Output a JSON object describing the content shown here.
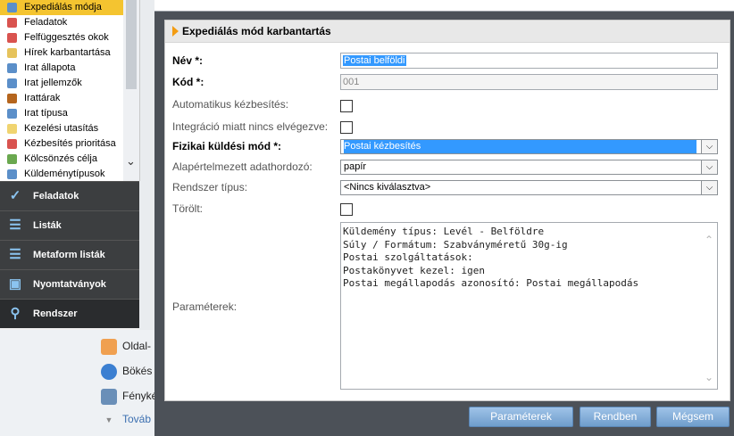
{
  "sidebar": {
    "items": [
      {
        "label": "Expediálás módja",
        "icon": "arrows-icon",
        "color": "#5b8fc9"
      },
      {
        "label": "Feladatok",
        "icon": "dots-icon",
        "color": "#d9534f"
      },
      {
        "label": "Felfüggesztés okok",
        "icon": "lock-icon",
        "color": "#d9534f"
      },
      {
        "label": "Hírek karbantartása",
        "icon": "document-icon",
        "color": "#e6c35c"
      },
      {
        "label": "Irat állapota",
        "icon": "document-status-icon",
        "color": "#5b8fc9"
      },
      {
        "label": "Irat jellemzők",
        "icon": "document-props-icon",
        "color": "#5b8fc9"
      },
      {
        "label": "Irattárak",
        "icon": "archive-icon",
        "color": "#b5651d"
      },
      {
        "label": "Irat típusa",
        "icon": "document-type-icon",
        "color": "#5b8fc9"
      },
      {
        "label": "Kezelési utasítás",
        "icon": "note-icon",
        "color": "#f0d470"
      },
      {
        "label": "Kézbesítés prioritása",
        "icon": "calendar-icon",
        "color": "#d9534f"
      },
      {
        "label": "Kölcsönzés célja",
        "icon": "lend-icon",
        "color": "#6aa84f"
      },
      {
        "label": "Küldeménytípusok",
        "icon": "package-icon",
        "color": "#5b8fc9"
      }
    ],
    "sections": [
      {
        "label": "Feladatok",
        "icon": "check-icon",
        "glyph": "✓"
      },
      {
        "label": "Listák",
        "icon": "list-icon",
        "glyph": "☰"
      },
      {
        "label": "Metaform listák",
        "icon": "metaform-list-icon",
        "glyph": "☰"
      },
      {
        "label": "Nyomtatványok",
        "icon": "form-icon",
        "glyph": "▣"
      },
      {
        "label": "Rendszer",
        "icon": "system-search-icon",
        "glyph": "⚲"
      }
    ],
    "sub_items": [
      {
        "label": "Oldal-",
        "icon": "page-icon",
        "color": "#f0a050"
      },
      {
        "label": "Bökés",
        "icon": "poke-icon",
        "color": "#3b7fd1"
      },
      {
        "label": "Fénykép",
        "icon": "photo-icon",
        "color": "#6a8fb8"
      },
      {
        "label": "Továb",
        "icon": "chevron-down-icon",
        "color": "#888888"
      }
    ]
  },
  "panel": {
    "title": "Expediálás mód karbantartás",
    "fields": {
      "nev_label": "Név *:",
      "nev_value": "Postai belföldi",
      "kod_label": "Kód *:",
      "kod_value": "001",
      "automatikus_label": "Automatikus kézbesítés:",
      "integracio_label": "Integráció miatt nincs elvégezve:",
      "fizikai_label": "Fizikai küldési mód *:",
      "fizikai_value": "Postai kézbesítés",
      "alapertelmezett_label": "Alapértelmezett adathordozó:",
      "alapertelmezett_value": "papír",
      "rendszer_label": "Rendszer típus:",
      "rendszer_value": "<Nincs kiválasztva>",
      "torolt_label": "Törölt:",
      "parameterek_label": "Paraméterek:",
      "parameterek_value": "Küldemény típus: Levél - Belföldre\nSúly / Formátum: Szabványméretű 30g-ig\nPostai szolgáltatások:\nPostakönyvet kezel: igen\nPostai megállapodás azonosító: Postai megállapodás"
    }
  },
  "footer": {
    "parameterek_button": "Paraméterek",
    "rendben_button": "Rendben",
    "megsem_button": "Mégsem"
  }
}
